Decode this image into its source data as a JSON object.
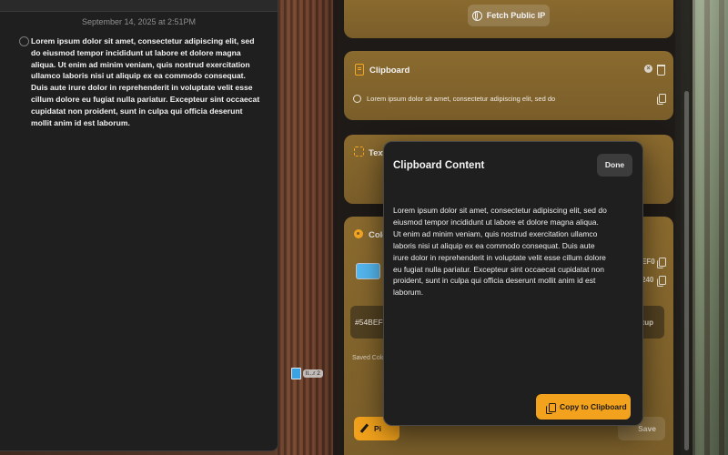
{
  "notes_window": {
    "date": "September 14, 2025 at 2:51PM",
    "note_text": "Lorem ipsum dolor sit amet, consectetur adipiscing elit, sed do eiusmod tempor incididunt ut labore et dolore magna aliqua. Ut enim ad minim veniam, quis nostrud exercitation ullamco laboris nisi ut aliquip ex ea commodo consequat. Duis aute irure dolor in reprehenderit in voluptate velit esse cillum dolore eu fugiat nulla pariatur. Excepteur sint occaecat cupidatat non proident, sunt in culpa qui officia deserunt mollit anim id est laborum."
  },
  "utility_panel": {
    "fetch_label": "Fetch Public IP",
    "clipboard_title": "Clipboard",
    "clipboard_item": "Lorem ipsum dolor sit amet, consectetur adipiscing elit, sed do",
    "text_title": "Text",
    "color_title": "Colo",
    "color_value_1": "EF0",
    "color_value_2": "240",
    "hex_value": "#54BEF",
    "hex_button": "ɪup",
    "saved_label": "Saved Colo",
    "pick_label": "Pi",
    "save_label": "Save",
    "swatch_color": "#54B8F0",
    "accent_color": "#F2A21C"
  },
  "desktop": {
    "file_label": "ll...r 2"
  },
  "modal": {
    "title": "Clipboard Content",
    "done_label": "Done",
    "body": "Lorem ipsum dolor sit amet, consectetur adipiscing elit, sed do eiusmod tempor incididunt ut labore et dolore magna aliqua. Ut enim ad minim veniam, quis nostrud exercitation ullamco laboris nisi ut aliquip ex ea commodo consequat. Duis aute irure dolor in reprehenderit in voluptate velit esse cillum dolore eu fugiat nulla pariatur. Excepteur sint occaecat cupidatat non proident, sunt in culpa qui officia deserunt mollit anim id est laborum.",
    "copy_label": "Copy to Clipboard"
  }
}
